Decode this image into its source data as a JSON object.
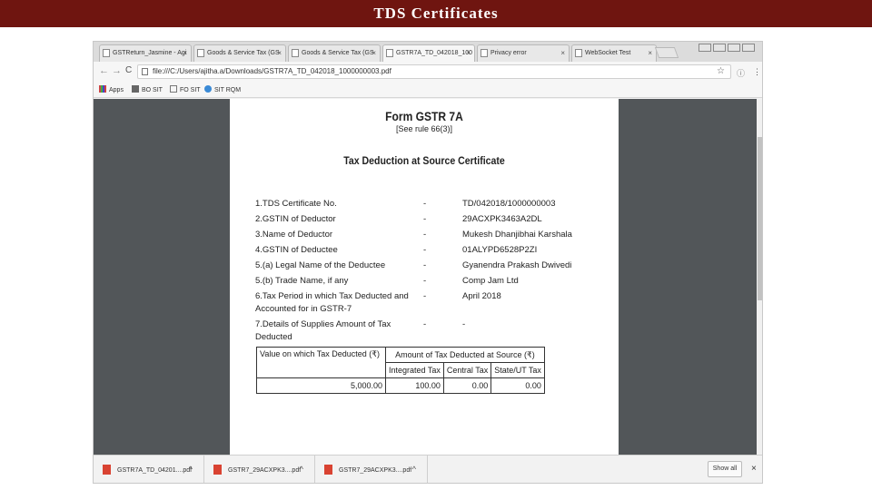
{
  "slide": {
    "title": "TDS Certificates"
  },
  "browser": {
    "tabs": [
      {
        "label": "GSTReturn_Jasmine - Agi"
      },
      {
        "label": "Goods & Service Tax (GS"
      },
      {
        "label": "Goods & Service Tax (GS"
      },
      {
        "label": "GSTR7A_TD_042018_100"
      },
      {
        "label": "Privacy error"
      },
      {
        "label": "WebSocket Test"
      }
    ],
    "address": "file:///C:/Users/ajitha.a/Downloads/GSTR7A_TD_042018_1000000003.pdf",
    "bookmarks": [
      {
        "label": "Apps"
      },
      {
        "label": "BO SIT"
      },
      {
        "label": "FO SIT"
      },
      {
        "label": "SIT RQM"
      }
    ]
  },
  "form": {
    "title": "Form GSTR 7A",
    "rule": "[See rule 66(3)]",
    "cert_title": "Tax Deduction at Source Certificate",
    "rows": [
      {
        "label": "1.TDS Certificate No.",
        "sep": "-",
        "value": "TD/042018/1000000003"
      },
      {
        "label": "2.GSTIN of Deductor",
        "sep": "-",
        "value": "29ACXPK3463A2DL"
      },
      {
        "label": "3.Name of Deductor",
        "sep": "-",
        "value": "Mukesh Dhanjibhai Karshala"
      },
      {
        "label": "4.GSTIN of Deductee",
        "sep": "-",
        "value": "01ALYPD6528P2ZI"
      },
      {
        "label": "5.(a) Legal Name of the Deductee",
        "sep": "-",
        "value": "Gyanendra Prakash Dwivedi"
      },
      {
        "label": "5.(b) Trade Name, if any",
        "sep": "-",
        "value": "Comp  Jam Ltd"
      },
      {
        "label_line1": "6.Tax Period in which Tax Deducted and",
        "label_line2": "Accounted for in GSTR-7",
        "sep": "-",
        "value": "April 2018"
      },
      {
        "label_line1": "7.Details of Supplies Amount of Tax",
        "label_line2": "Deducted",
        "sep": "-",
        "value": "-"
      }
    ],
    "table": {
      "col_value": "Value on which Tax Deducted (₹)",
      "col_amount": "Amount of Tax Deducted at Source (₹)",
      "sub_integrated": "Integrated Tax",
      "sub_central": "Central Tax",
      "sub_state": "State/UT Tax",
      "row": {
        "value": "5,000.00",
        "integrated": "100.00",
        "central": "0.00",
        "state": "0.00"
      }
    }
  },
  "downloads": {
    "items": [
      {
        "name": "GSTR7A_TD_04201....pdf"
      },
      {
        "name": "GSTR7_29ACXPK3....pdf"
      },
      {
        "name": "GSTR7_29ACXPK3....pdf"
      }
    ],
    "show_all": "Show all"
  },
  "icons": {
    "back": "←",
    "forward": "→",
    "reload": "C",
    "info": "ⓘ",
    "star": "☆",
    "menu": "⋮",
    "close": "×",
    "caret": "^"
  }
}
